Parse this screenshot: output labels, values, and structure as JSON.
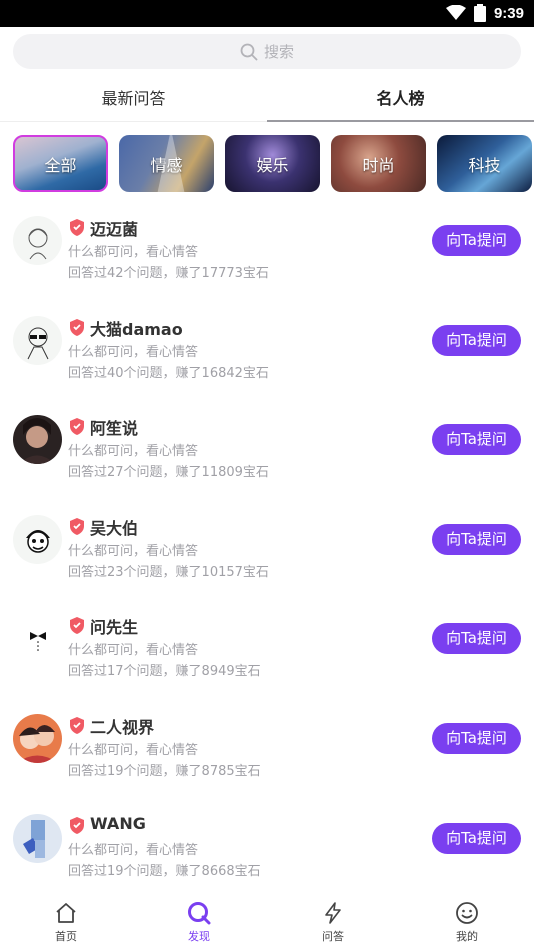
{
  "status": {
    "time": "9:39"
  },
  "search": {
    "placeholder": "搜索"
  },
  "tabs": [
    {
      "label": "最新问答"
    },
    {
      "label": "名人榜"
    }
  ],
  "categories": [
    {
      "label": "全部"
    },
    {
      "label": "情感"
    },
    {
      "label": "娱乐"
    },
    {
      "label": "时尚"
    },
    {
      "label": "科技"
    }
  ],
  "list": [
    {
      "name": "迈迈菌",
      "desc": "什么都可问，看心情答",
      "stats": "回答过42个问题，赚了17773宝石",
      "button": "向Ta提问"
    },
    {
      "name": "大猫damao",
      "desc": "什么都可问，看心情答",
      "stats": "回答过40个问题，赚了16842宝石",
      "button": "向Ta提问"
    },
    {
      "name": "阿笙说",
      "desc": "什么都可问，看心情答",
      "stats": "回答过27个问题，赚了11809宝石",
      "button": "向Ta提问"
    },
    {
      "name": "吴大伯",
      "desc": "什么都可问，看心情答",
      "stats": "回答过23个问题，赚了10157宝石",
      "button": "向Ta提问"
    },
    {
      "name": "问先生",
      "desc": "什么都可问，看心情答",
      "stats": "回答过17个问题，赚了8949宝石",
      "button": "向Ta提问"
    },
    {
      "name": "二人视界",
      "desc": "什么都可问，看心情答",
      "stats": "回答过19个问题，赚了8785宝石",
      "button": "向Ta提问"
    },
    {
      "name": "WANG",
      "desc": "什么都可问，看心情答",
      "stats": "回答过19个问题，赚了8668宝石",
      "button": "向Ta提问"
    }
  ],
  "nav": [
    {
      "label": "首页",
      "icon": "home-icon"
    },
    {
      "label": "发现",
      "icon": "discover-icon"
    },
    {
      "label": "问答",
      "icon": "lightning-icon"
    },
    {
      "label": "我的",
      "icon": "smiley-icon"
    }
  ],
  "colors": {
    "accent": "#7a3ff0",
    "active_border": "#d13ce0",
    "badge": "#f05a64"
  }
}
